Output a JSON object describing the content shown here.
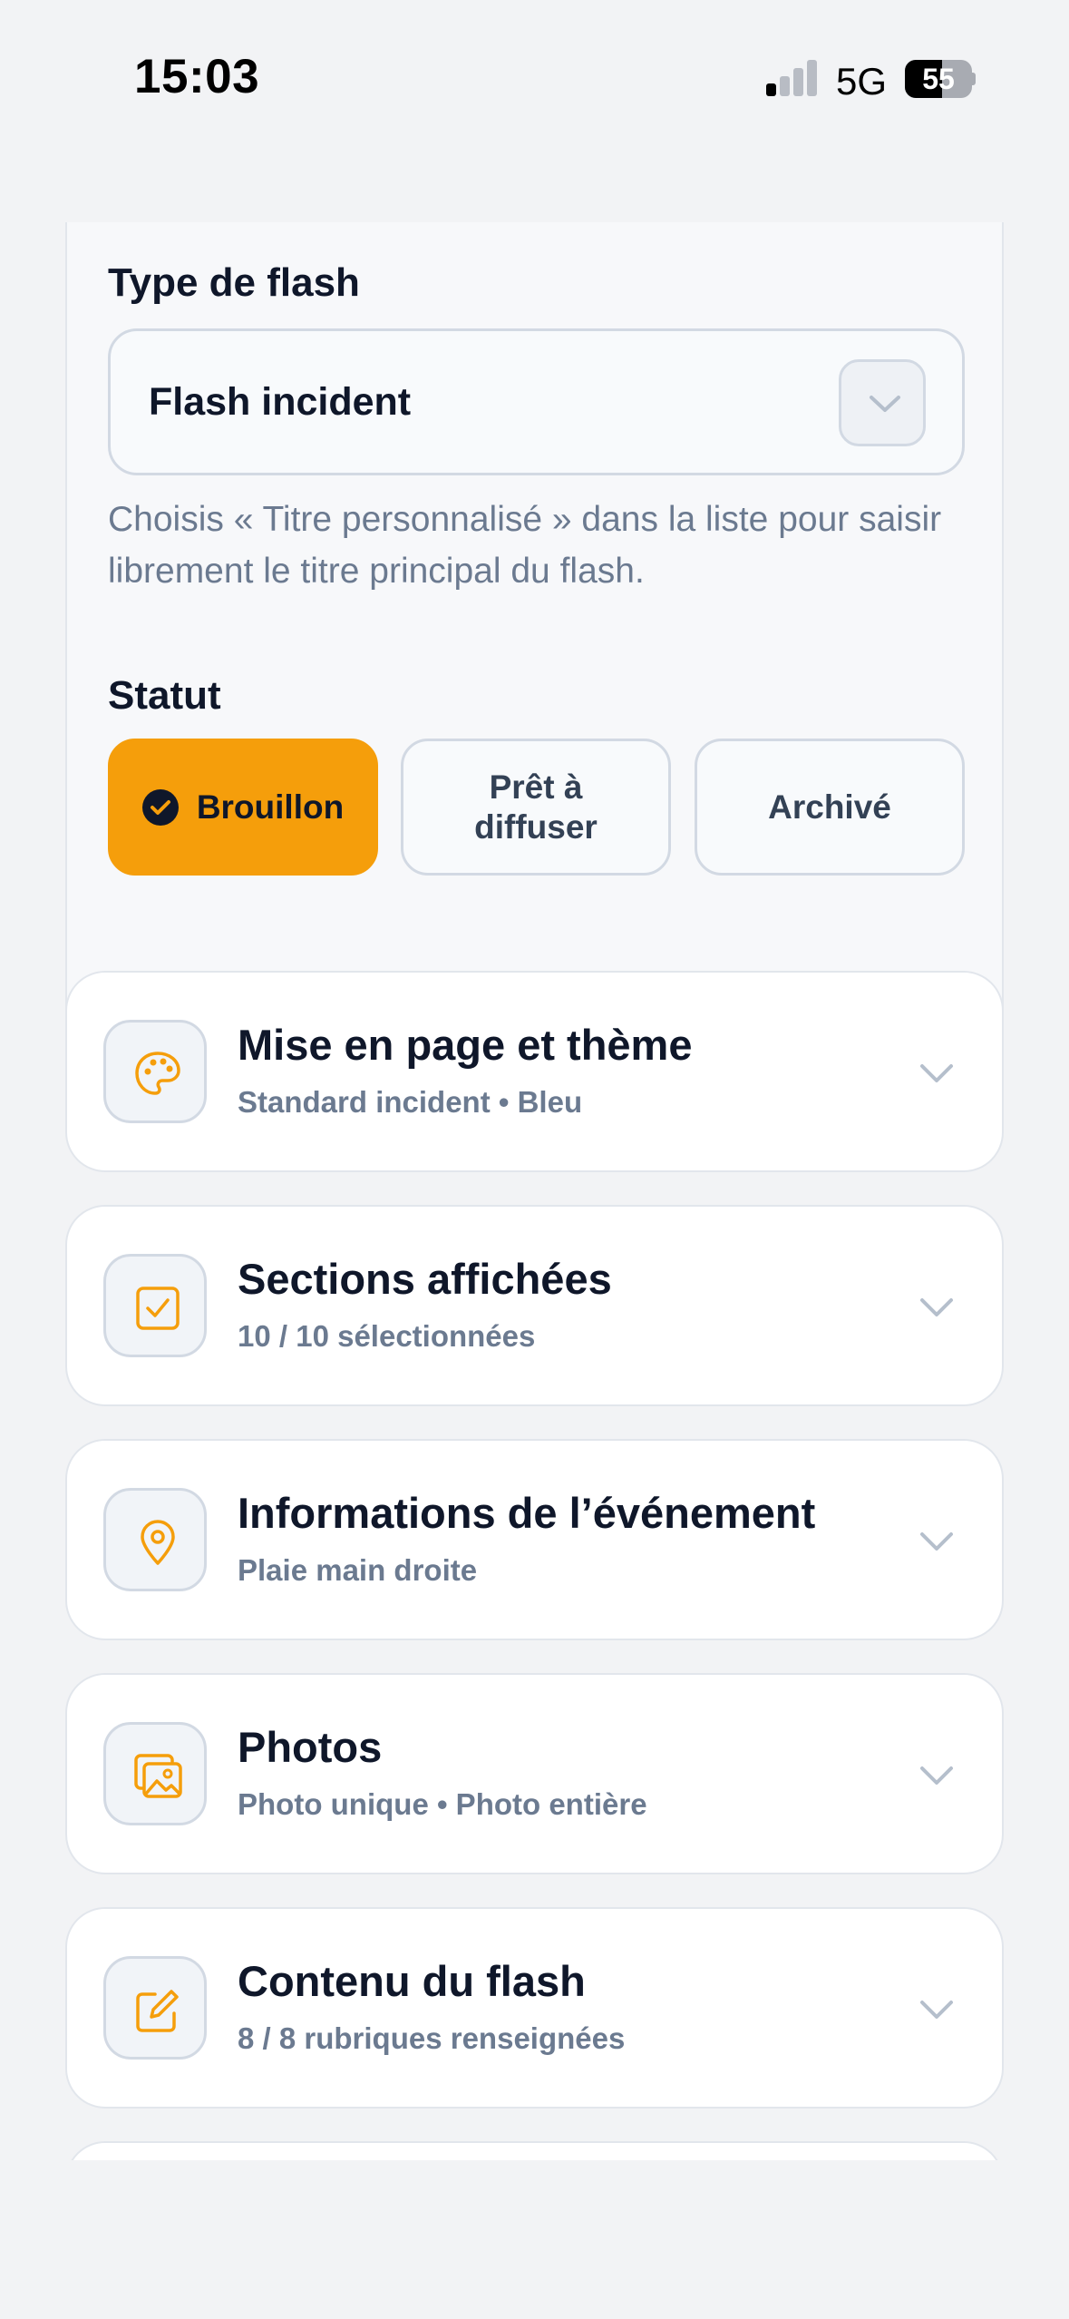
{
  "status_bar": {
    "time": "15:03",
    "network": "5G",
    "battery": "55",
    "battery_level": 0.55
  },
  "flash_type": {
    "label": "Type de flash",
    "value": "Flash incident",
    "helper": "Choisis « Titre personnalisé » dans la liste pour saisir librement le titre principal du flash."
  },
  "statut": {
    "label": "Statut",
    "options": [
      "Brouillon",
      "Prêt à diffuser",
      "Archivé"
    ],
    "selected": "Brouillon"
  },
  "sections": [
    {
      "title": "Mise en page et thème",
      "subtitle": "Standard incident • Bleu",
      "icon": "palette-icon"
    },
    {
      "title": "Sections affichées",
      "subtitle": "10 / 10 sélectionnées",
      "icon": "checkbox-icon"
    },
    {
      "title": "Informations de l’événement",
      "subtitle": "Plaie main droite",
      "icon": "map-pin-icon"
    },
    {
      "title": "Photos",
      "subtitle": "Photo unique • Photo entière",
      "icon": "photos-icon"
    },
    {
      "title": "Contenu du flash",
      "subtitle": "8 / 8 rubriques renseignées",
      "icon": "edit-icon"
    }
  ],
  "colors": {
    "accent": "#f59e0b",
    "text": "#0f172a",
    "muted": "#6b7a90",
    "background": "#f2f3f5"
  }
}
